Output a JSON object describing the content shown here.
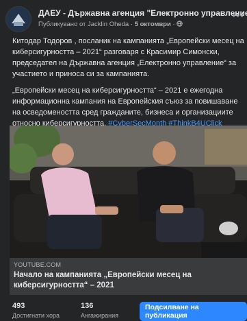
{
  "post": {
    "page_name": "ДАЕУ - Държавна агенция \"Електронно управление\"",
    "published_by": "Публикувано от Jacklin Oheda",
    "date": "5 октомври",
    "paragraphs": [
      "Китодар Тодоров , посланик на кампанията „Европейски месец на киберсигурността – 2021“ разговаря с  Красимир Симонски, председател на Държавна агенция „Електронно управление“ за участието и приноса си за кампанията.",
      "„Европейски месец на киберсигурността“ – 2021 е ежегодна информационна кампания на Европейския съюз за повишаване на осведомеността сред гражданите, бизнеса и организациите относно киберсигурността."
    ],
    "hashtags": "#CyberSecMonth #ThinkB4UClick",
    "more_icon": "ellipsis-icon",
    "globe_icon": "globe-icon"
  },
  "link_card": {
    "source": "YOUTUBE.COM",
    "title": "Начало на кампанията „Европейски месец на киберсигурността“ – 2021"
  },
  "stats": {
    "reach_value": "493",
    "reach_label": "Достигнати хора",
    "engagement_value": "136",
    "engagement_label": "Ангажирания"
  },
  "boost_button": "Подсилване на публикация"
}
